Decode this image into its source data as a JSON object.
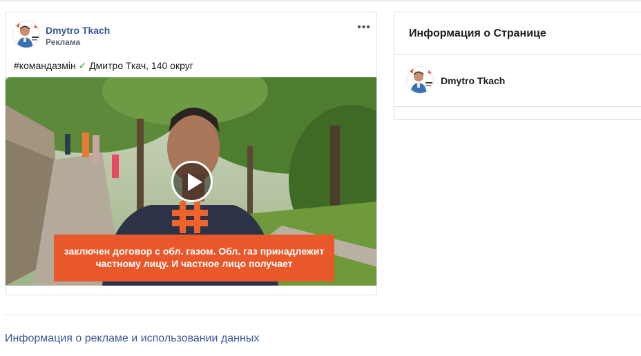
{
  "post": {
    "author": "Dmytro Tkach",
    "sponsored_label": "Реклама",
    "more_icon": "more-horizontal-icon",
    "text_prefix": "#командазмін",
    "text_check": "✓",
    "text_suffix": " Дмитро Ткач, 140 округ",
    "video": {
      "play_icon": "play-icon",
      "subtitle_line1": "заключен договор с обл. газом. Обл. газ принадлежит",
      "subtitle_line2": "частному лицу. И частное лицо получает"
    }
  },
  "page_info": {
    "title": "Информация о Странице",
    "page_name": "Dmytro Tkach"
  },
  "footer": {
    "link": "Информация о рекламе и использовании данных"
  },
  "colors": {
    "link_blue": "#365899",
    "check_green": "#2eab3c",
    "subtitle_orange": "#e8582b"
  }
}
